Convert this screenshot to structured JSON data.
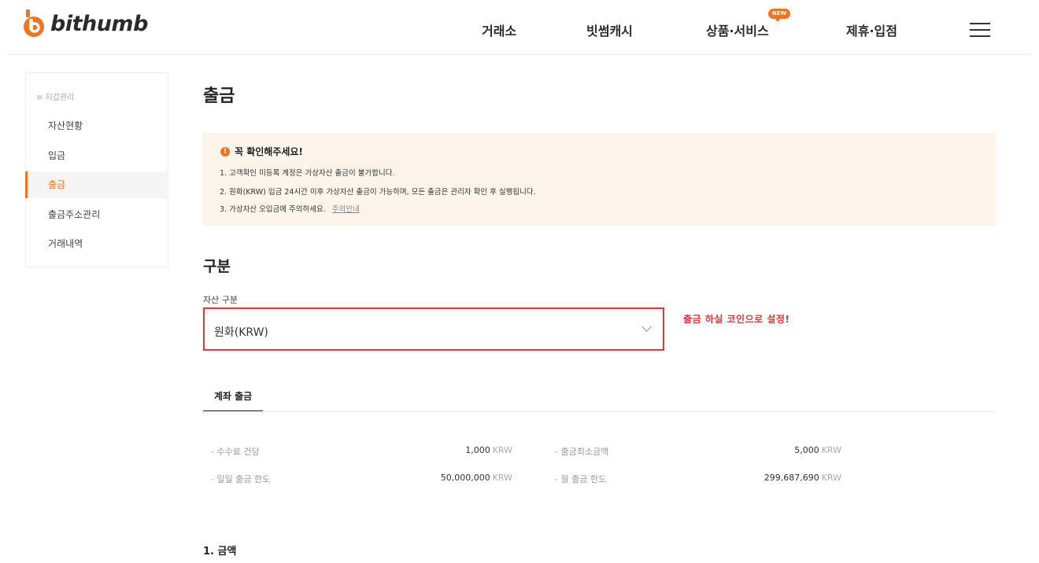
{
  "header": {
    "logo_text": "bithumb",
    "nav": [
      "거래소",
      "빗썸캐시",
      "상품·서비스",
      "제휴·입점"
    ],
    "new_badge": "NEW",
    "accent_color": "#f37321"
  },
  "sidebar": {
    "heading": "≡ 지갑관리",
    "items": [
      "자산현황",
      "입금",
      "출금",
      "출금주소관리",
      "거래내역"
    ],
    "active_index": 2
  },
  "main": {
    "title": "출금",
    "notice": {
      "icon": "!",
      "title": "꼭 확인해주세요!",
      "lines": [
        "1. 고객확인 미등록 계정은 가상자산 출금이 불가합니다.",
        "2. 원화(KRW) 입금 24시간 이후 가상자산 출금이 가능하며, 모든 출금은 관리자 확인 후 실행됩니다.",
        "3. 가상자산 오입금에 주의하세요."
      ],
      "link": "주의안내"
    },
    "section_title": "구분",
    "asset_label": "자산 구분",
    "asset_value": "원화(KRW)",
    "annotation": "출금 하실 코인으로 설정!",
    "annotation_color": "#e0353b",
    "tab": "계좌 출금",
    "fees": {
      "fee_label": "- 수수료 건당",
      "fee_value": "1,000",
      "min_label": "- 출금최소금액",
      "min_value": "5,000",
      "daily_label": "- 일일 출금 한도",
      "daily_value": "50,000,000",
      "monthly_label": "- 월 출금 한도",
      "monthly_value": "299,687,690",
      "unit": "KRW"
    },
    "amount_title": "1. 금액"
  }
}
